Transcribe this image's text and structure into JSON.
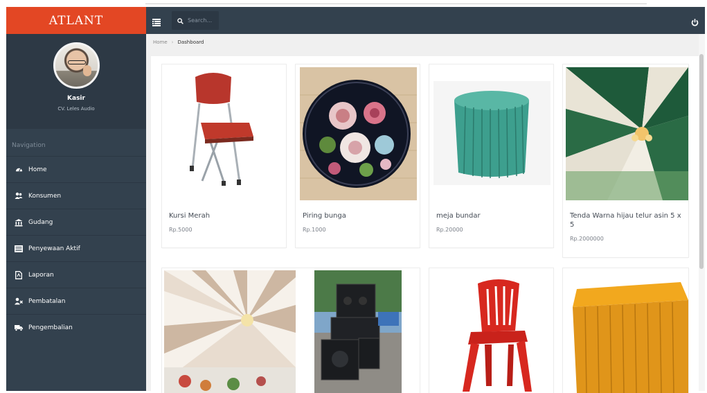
{
  "brand": "ATLANT",
  "profile": {
    "name": "Kasir",
    "company": "CV. Leles Audio"
  },
  "nav": {
    "title": "Navigation",
    "items": [
      {
        "label": "Home",
        "icon": "dashboard-icon"
      },
      {
        "label": "Konsumen",
        "icon": "users-icon"
      },
      {
        "label": "Gudang",
        "icon": "bank-icon"
      },
      {
        "label": "Penyewaan Aktif",
        "icon": "list-icon"
      },
      {
        "label": "Laporan",
        "icon": "file-icon"
      },
      {
        "label": "Pembatalan",
        "icon": "user-times-icon"
      },
      {
        "label": "Pengembalian",
        "icon": "truck-icon"
      }
    ]
  },
  "topbar": {
    "search_placeholder": "Search..."
  },
  "breadcrumb": {
    "home": "Home",
    "current": "Dashboard"
  },
  "products": [
    {
      "title": "Kursi Merah",
      "price": "Rp.5000"
    },
    {
      "title": "Piring bunga",
      "price": "Rp.1000"
    },
    {
      "title": "meja bundar",
      "price": "Rp.20000"
    },
    {
      "title": "Tenda Warna hijau telur asin 5 x 5",
      "price": "Rp.2000000"
    }
  ],
  "colors": {
    "brand": "#e34724",
    "sidebar": "#33414e",
    "panel_bg": "#f0f0f0"
  }
}
